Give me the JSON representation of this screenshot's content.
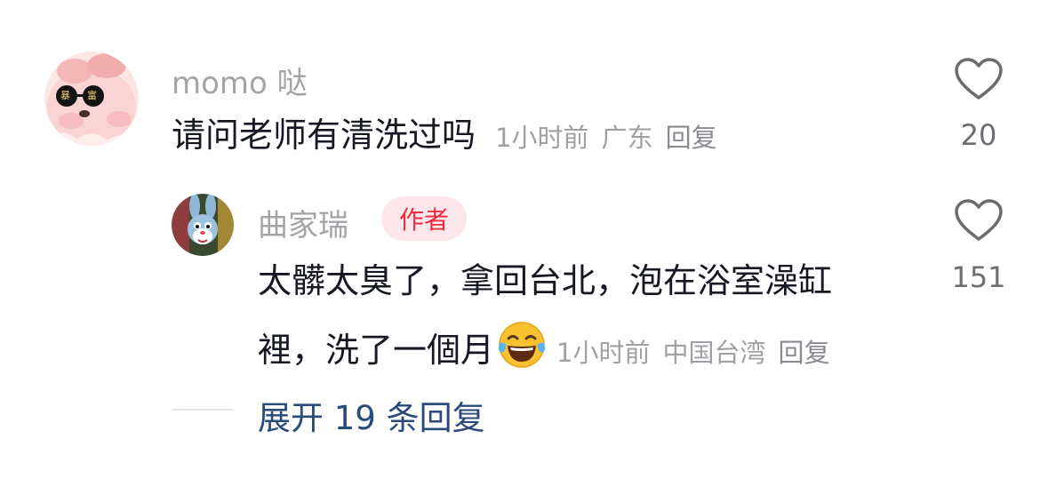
{
  "comment": {
    "username": "momo 哒",
    "text": "请问老师有清洗过吗",
    "time": "1小时前",
    "location": "广东",
    "reply_label": "回复",
    "likes": "20",
    "avatar_icon": "pink-pig-sunglasses-avatar",
    "avatar_glasses_text": "暴富"
  },
  "reply": {
    "username": "曲家瑞",
    "badge": "作者",
    "text_line1": "太髒太臭了，拿回台北，泡在浴室澡缸",
    "text_line2": "裡，洗了一個月",
    "emoji": "face-with-tears-of-joy",
    "time": "1小时前",
    "location": "中国台湾",
    "reply_label": "回复",
    "likes": "151",
    "avatar_icon": "cartoon-rabbit-avatar"
  },
  "expand": {
    "label": "展开 19 条回复"
  },
  "colors": {
    "badge_bg": "#fde7ea",
    "badge_text": "#f0293e",
    "expand_link": "#2a4a7a",
    "meta": "#a0a0a5"
  }
}
